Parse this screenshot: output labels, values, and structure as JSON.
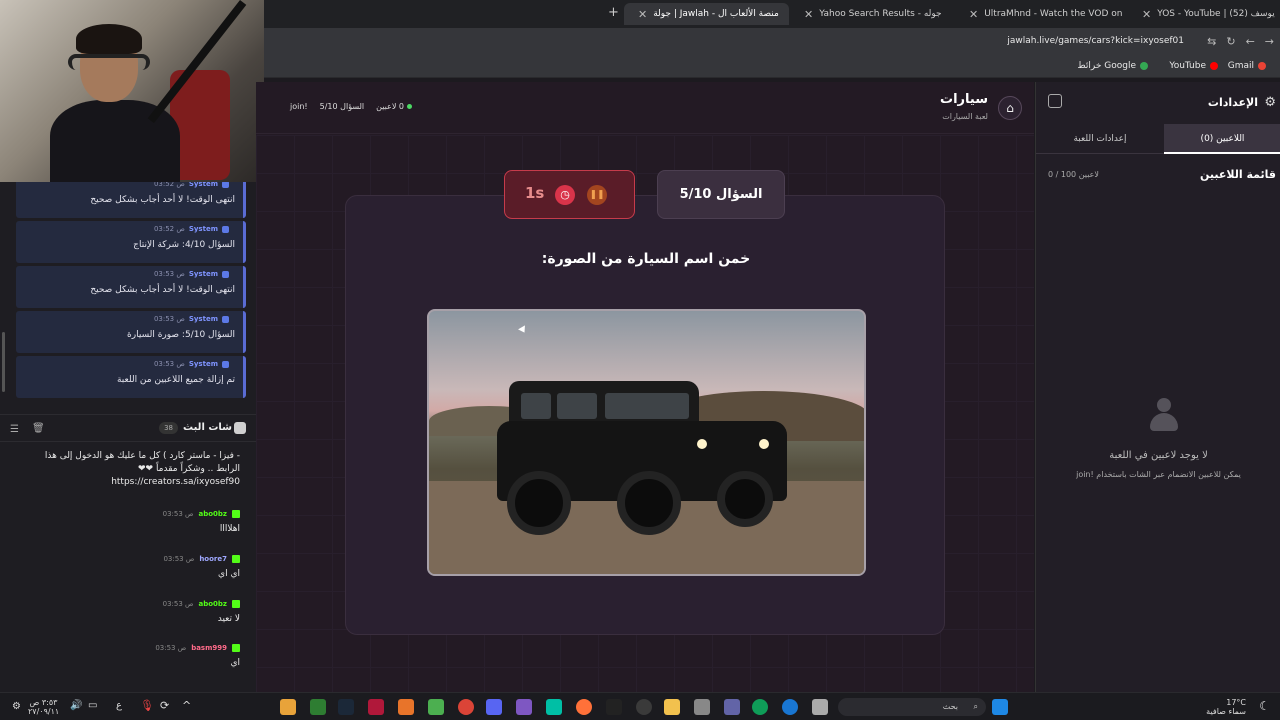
{
  "browser": {
    "tabs": [
      {
        "title": "YOS - YouTube | يوسف (52)",
        "color": "#ff0000"
      },
      {
        "title": "UltraMhnd - Watch the VOD on",
        "color": "#53fc18"
      },
      {
        "title": "Yahoo Search Results - جوله",
        "color": "#7b1fa2"
      },
      {
        "title": "جولة | Jawlah - منصة الألعاب ال",
        "color": "#ff5a7a"
      }
    ],
    "url": "jawlah.live/games/cars?kick=ixyosef01",
    "bookmarks": [
      "Gmail",
      "YouTube",
      "خرائط Google"
    ]
  },
  "stream_chat": {
    "system_messages": [
      {
        "user": "System",
        "time": "03:52 ص",
        "text": "انتهى الوقت! لا أحد أجاب بشكل صحيح"
      },
      {
        "user": "System",
        "time": "03:52 ص",
        "text": "السؤال 4/10: شركة الإنتاج"
      },
      {
        "user": "System",
        "time": "03:53 ص",
        "text": "انتهى الوقت! لا أحد أجاب بشكل صحيح"
      },
      {
        "user": "System",
        "time": "03:53 ص",
        "text": "السؤال 5/10: صورة السيارة"
      },
      {
        "user": "System",
        "time": "03:53 ص",
        "text": "تم إزالة جميع اللاعبين من اللعبة"
      }
    ],
    "title": "شات البث",
    "count": "38",
    "pinned_text_1": "- فيزا - ماستر كارد ) كل ما عليك هو الدخول إلى هذا",
    "pinned_text_2": "الرابط .. وشكراً مقدماً ❤❤",
    "pinned_link": "https://creators.sa/ixyosef90",
    "messages": [
      {
        "user": "abo0bz",
        "time": "03:53 ص",
        "text": "اهلاااا",
        "color": "#53fc18"
      },
      {
        "user": "hoore7",
        "time": "03:53 ص",
        "text": "اي اي",
        "color": "#9fa8ff"
      },
      {
        "user": "abo0bz",
        "time": "03:53 ص",
        "text": "لا تعيد",
        "color": "#53fc18"
      },
      {
        "user": "basm999",
        "time": "03:53 ص",
        "text": "اي",
        "color": "#ff6b8a"
      }
    ]
  },
  "game": {
    "title": "سيارات",
    "subtitle": "لعبة السيارات",
    "players_online": "0 لاعبين",
    "question_status": "السؤال 5/10",
    "join_hint": "!join",
    "timer": "1s",
    "question_label": "السؤال 5/10",
    "prompt": "خمن اسم السيارة من الصورة:"
  },
  "settings_panel": {
    "title": "الإعدادات",
    "tab_players": "اللاعبين (0)",
    "tab_game_settings": "إعدادات اللعبة",
    "players_list_title": "قائمة اللاعبين",
    "players_count": "0 / 100 لاعبين",
    "empty_title": "لا يوجد لاعبين في اللعبة",
    "empty_hint": "يمكن للاعبين الانضمام عبر الشات باستخدام !join"
  },
  "taskbar": {
    "time": "٣:٥٣ ص",
    "date": "٢٧/٠٩/١١",
    "search_placeholder": "بحث",
    "weather_temp": "17°C",
    "weather_desc": "سماء صافية"
  }
}
